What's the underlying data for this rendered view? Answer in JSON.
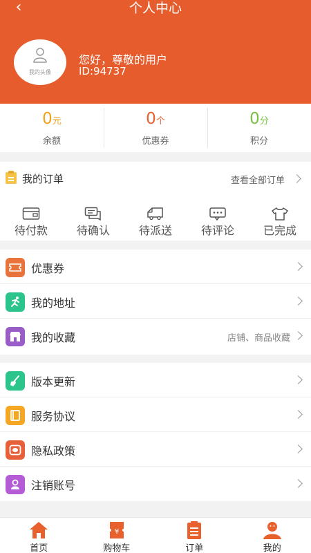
{
  "header": {
    "title": "个人中心",
    "back_icon": "chevron-left-icon",
    "avatar_label": "我的头像",
    "greeting": "您好，尊敬的用户",
    "user_id": "ID:94737",
    "color": "#e65c2c"
  },
  "stats": [
    {
      "value": "0",
      "unit": "元",
      "label": "余额",
      "color": "#f0a21e"
    },
    {
      "value": "0",
      "unit": "个",
      "label": "优惠券",
      "color": "#e8602c"
    },
    {
      "value": "0",
      "unit": "分",
      "label": "积分",
      "color": "#7ac043"
    }
  ],
  "orders": {
    "title": "我的订单",
    "view_all": "查看全部订单",
    "items": [
      {
        "label": "待付款",
        "icon": "wallet-icon"
      },
      {
        "label": "待确认",
        "icon": "chat-icon"
      },
      {
        "label": "待派送",
        "icon": "truck-icon"
      },
      {
        "label": "待评论",
        "icon": "comment-icon"
      },
      {
        "label": "已完成",
        "icon": "shirt-icon"
      }
    ]
  },
  "menu_group1": [
    {
      "label": "优惠券",
      "icon": "ticket-icon",
      "color": "#e8743c"
    },
    {
      "label": "我的地址",
      "icon": "runner-icon",
      "color": "#2bc48a"
    },
    {
      "label": "我的收藏",
      "icon": "shop-icon",
      "color": "#9a5cc6",
      "sub": "店铺、商品收藏"
    }
  ],
  "menu_group2": [
    {
      "label": "版本更新",
      "icon": "broom-icon",
      "color": "#2bc48a"
    },
    {
      "label": "服务协议",
      "icon": "book-icon",
      "color": "#f5a623"
    },
    {
      "label": "隐私政策",
      "icon": "privacy-icon",
      "color": "#e8603a"
    },
    {
      "label": "注销账号",
      "icon": "user-badge-icon",
      "color": "#b45cd6"
    }
  ],
  "tabbar": [
    {
      "label": "首页",
      "icon": "home-icon"
    },
    {
      "label": "购物车",
      "icon": "cart-icon"
    },
    {
      "label": "订单",
      "icon": "order-list-icon"
    },
    {
      "label": "我的",
      "icon": "profile-icon"
    }
  ]
}
